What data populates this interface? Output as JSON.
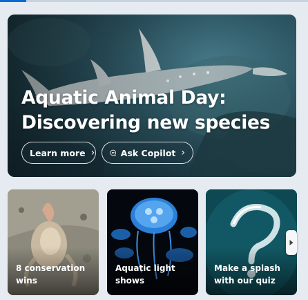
{
  "hero": {
    "title_line1": "Aquatic Animal Day:",
    "title_line2": "Discovering new species",
    "learn_more_label": "Learn more",
    "ask_copilot_label": "Ask Copilot"
  },
  "cards": [
    {
      "label": "8 conservation wins"
    },
    {
      "label": "Aquatic light shows"
    },
    {
      "label": "Make a splash with our quiz"
    }
  ],
  "icons": {
    "chevron": "chevron-right-icon",
    "copilot": "copilot-chat-icon",
    "scroll": "carousel-next-icon"
  },
  "colors": {
    "accent": "#0b6ad6",
    "page_background": "#e6ebf2",
    "text_on_image": "#ffffff"
  }
}
